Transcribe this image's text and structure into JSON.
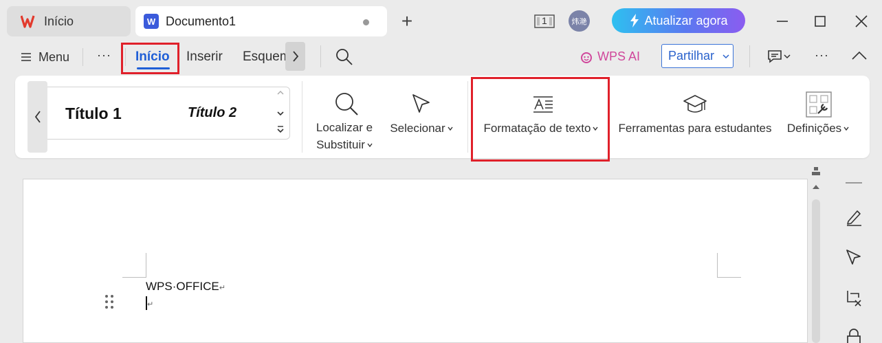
{
  "tabs": {
    "home_label": "Início",
    "document_label": "Documento1",
    "document_icon": "W"
  },
  "titlebar": {
    "avatar_text": "炜滟",
    "window_count": "1",
    "upgrade_label": "Atualizar agora"
  },
  "ribbon_tabs": {
    "menu_label": "Menu",
    "more_label": "···",
    "active_tab": "Início",
    "insert_tab": "Inserir",
    "layout_tab": "Esquem",
    "wps_ai_label": "WPS AI",
    "share_label": "Partilhar"
  },
  "styles": {
    "style1": "Título 1",
    "style2": "Título 2"
  },
  "ribbon_buttons": {
    "find_label_line1": "Localizar e",
    "find_label_line2": "Substituir",
    "select_label": "Selecionar",
    "text_format_label": "Formatação de texto",
    "student_tools_label": "Ferramentas para estudantes",
    "settings_label": "Definições"
  },
  "document": {
    "line1": "WPS·OFFICE",
    "paragraph_mark": "↵"
  },
  "colors": {
    "accent_blue": "#1f5ed6",
    "highlight_red": "#e0202a",
    "wps_ai_pink": "#d0479b"
  },
  "icons": [
    "wps-logo-icon",
    "word-doc-icon",
    "plus-icon",
    "window-count-icon",
    "bolt-icon",
    "minimize-icon",
    "maximize-icon",
    "close-icon",
    "menu-icon",
    "chevron-right-icon",
    "search-icon",
    "wps-ai-icon",
    "chevron-down-icon",
    "comment-icon",
    "more-icon",
    "collapse-ribbon-icon",
    "chevron-left-icon",
    "find-replace-icon",
    "select-cursor-icon",
    "text-format-icon",
    "graduation-cap-icon",
    "settings-icon",
    "drag-handle-icon",
    "pen-icon",
    "cursor-icon",
    "crop-clear-icon",
    "lock-icon"
  ]
}
